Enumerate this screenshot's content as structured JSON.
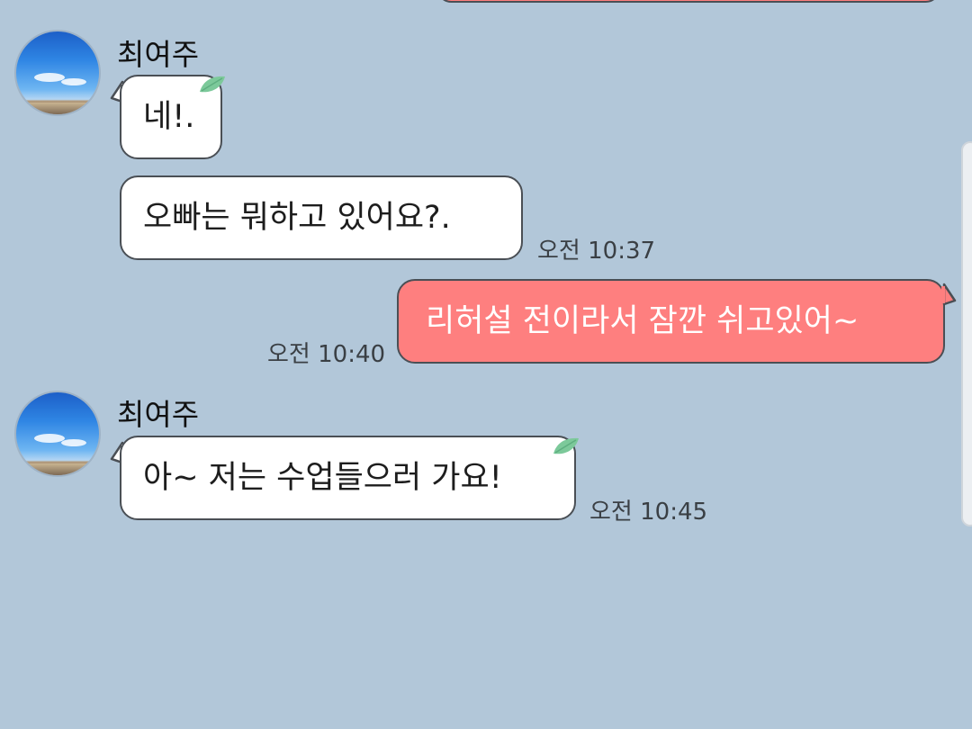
{
  "chat": {
    "groups": [
      {
        "sender": "최여주",
        "messages": [
          "네!.",
          "오빠는 뭐하고 있어요?."
        ],
        "time": "오전 10:37"
      },
      {
        "sent": "리허설 전이라서 잠깐 쉬고있어~",
        "time": "오전 10:40"
      },
      {
        "sender": "최여주",
        "messages": [
          "아~ 저는 수업들으러 가요!"
        ],
        "time": "오전 10:45"
      }
    ]
  },
  "colors": {
    "background": "#b2c7d9",
    "received_bubble": "#ffffff",
    "sent_bubble": "#fe7f7f",
    "bubble_border": "#4a4f55",
    "leaf": "#7cc99a"
  },
  "icons": [
    "profile-avatar",
    "leaf-sticker-icon"
  ]
}
